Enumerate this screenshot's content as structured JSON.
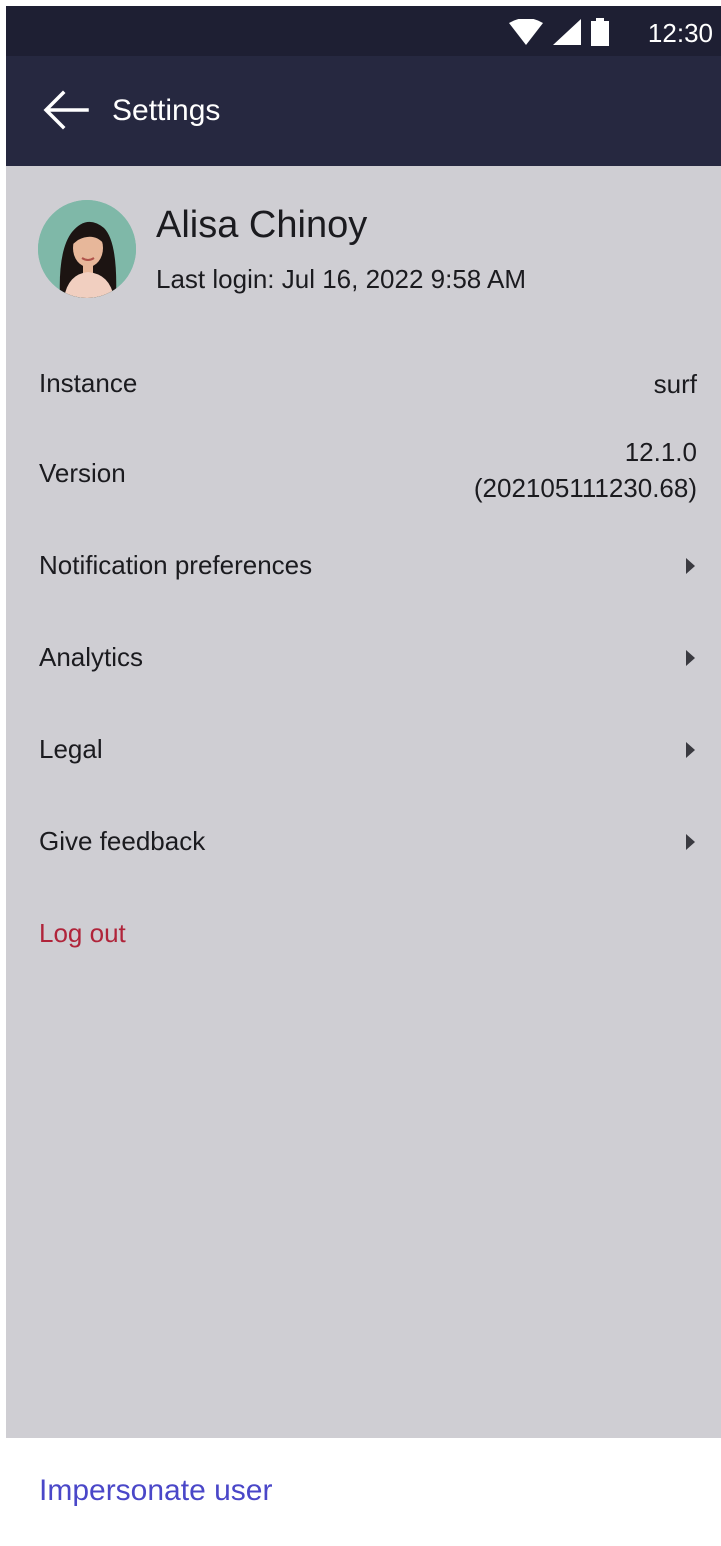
{
  "status_bar": {
    "time": "12:30",
    "icons": [
      "wifi-icon",
      "cellular-signal-icon",
      "battery-icon"
    ]
  },
  "app_bar": {
    "title": "Settings",
    "back_icon": "arrow-left-icon"
  },
  "profile": {
    "name": "Alisa Chinoy",
    "last_login": "Last login: Jul 16, 2022 9:58 AM"
  },
  "rows": {
    "instance": {
      "label": "Instance",
      "value": "surf"
    },
    "version": {
      "label": "Version",
      "value_line1": "12.1.0",
      "value_line2": "(202105111230.68)"
    },
    "notification_preferences": {
      "label": "Notification preferences"
    },
    "analytics": {
      "label": "Analytics"
    },
    "legal": {
      "label": "Legal"
    },
    "give_feedback": {
      "label": "Give feedback"
    },
    "log_out": {
      "label": "Log out"
    }
  },
  "bottom_sheet": {
    "action_label": "Impersonate user"
  },
  "colors": {
    "status_bar_bg": "#1e1f33",
    "app_bar_bg": "#262840",
    "content_bg": "#cfced3",
    "logout_text": "#b0243a",
    "action_text": "#4a47c8"
  }
}
